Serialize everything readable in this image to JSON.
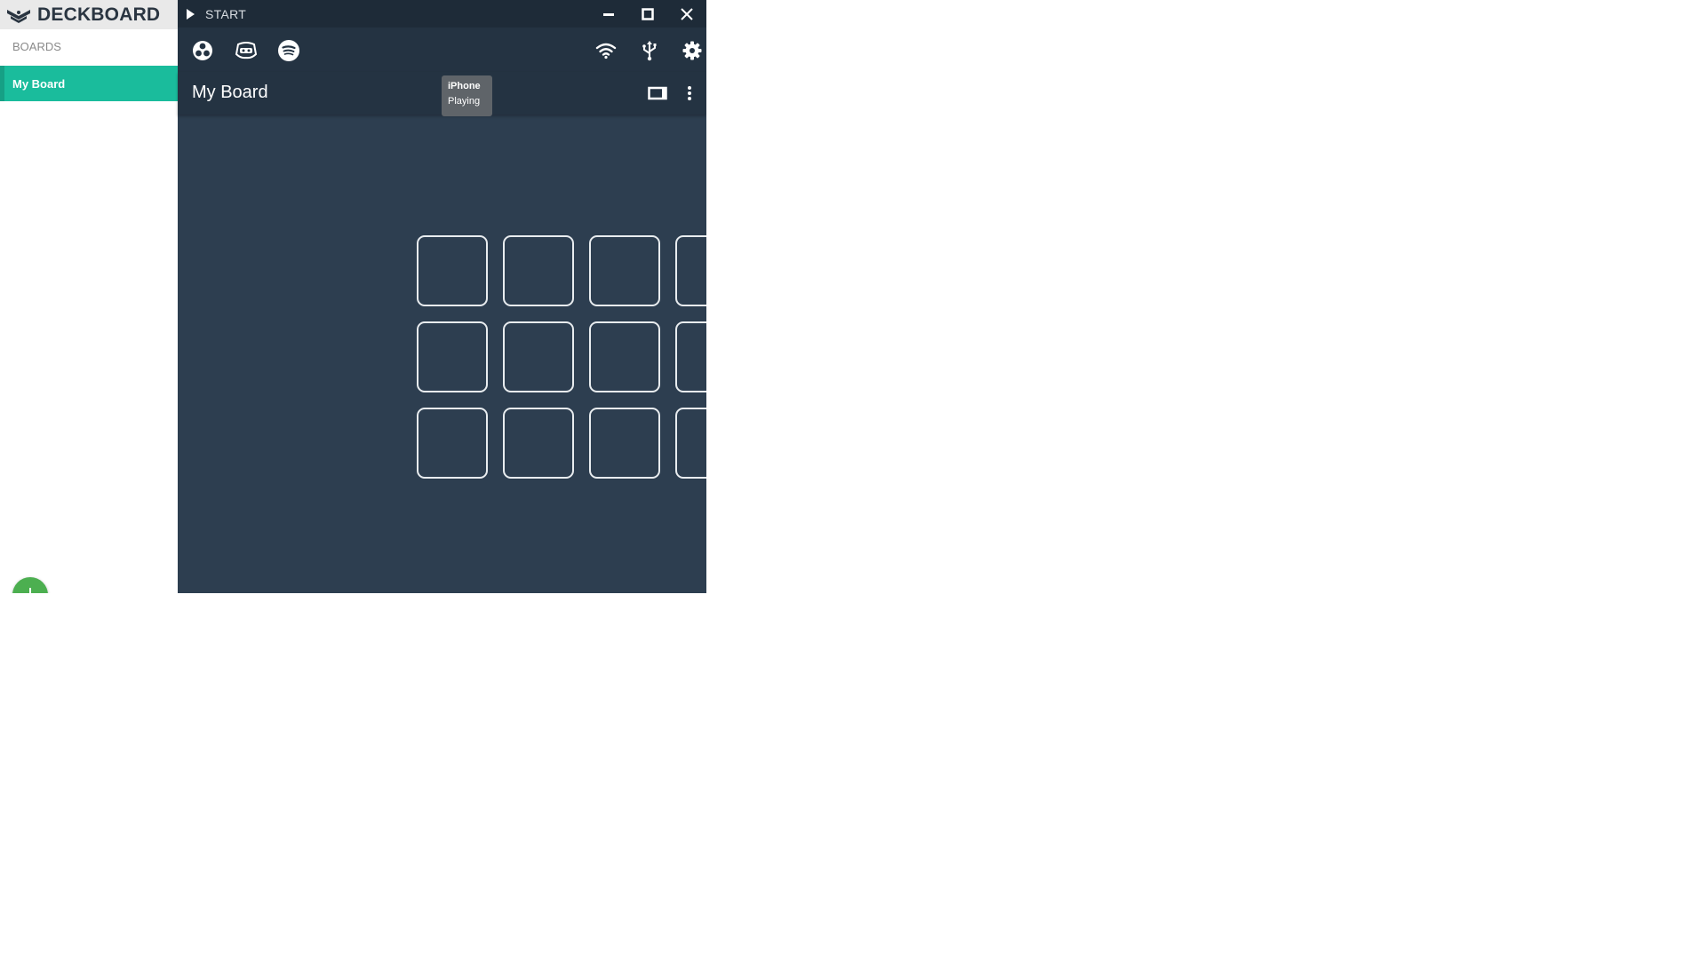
{
  "sidebar": {
    "brand": "DECKBOARD",
    "section_label": "BOARDS",
    "boards": [
      {
        "label": "My Board",
        "active": true
      }
    ],
    "add_button_icon": "plus-icon"
  },
  "titlebar": {
    "start_label": "START",
    "controls": [
      "minimize-icon",
      "maximize-icon",
      "close-icon"
    ]
  },
  "toolbar": {
    "left_icons": [
      "obs-icon",
      "discord-icon",
      "spotify-icon"
    ],
    "right_icons": [
      "wifi-icon",
      "usb-icon",
      "settings-icon"
    ]
  },
  "tooltip": {
    "line1": "iPhone",
    "line2": "Playing"
  },
  "board": {
    "title": "My Board",
    "header_icons": [
      "layout-icon",
      "more-vertical-icon"
    ],
    "grid": {
      "rows": 3,
      "columns": 5
    }
  },
  "colors": {
    "accent": "#1abc9c",
    "main_bg": "#2d3e50",
    "titlebar_bg": "#1e2b38",
    "toolbar_bg": "#243342",
    "fab": "#4caf50"
  }
}
